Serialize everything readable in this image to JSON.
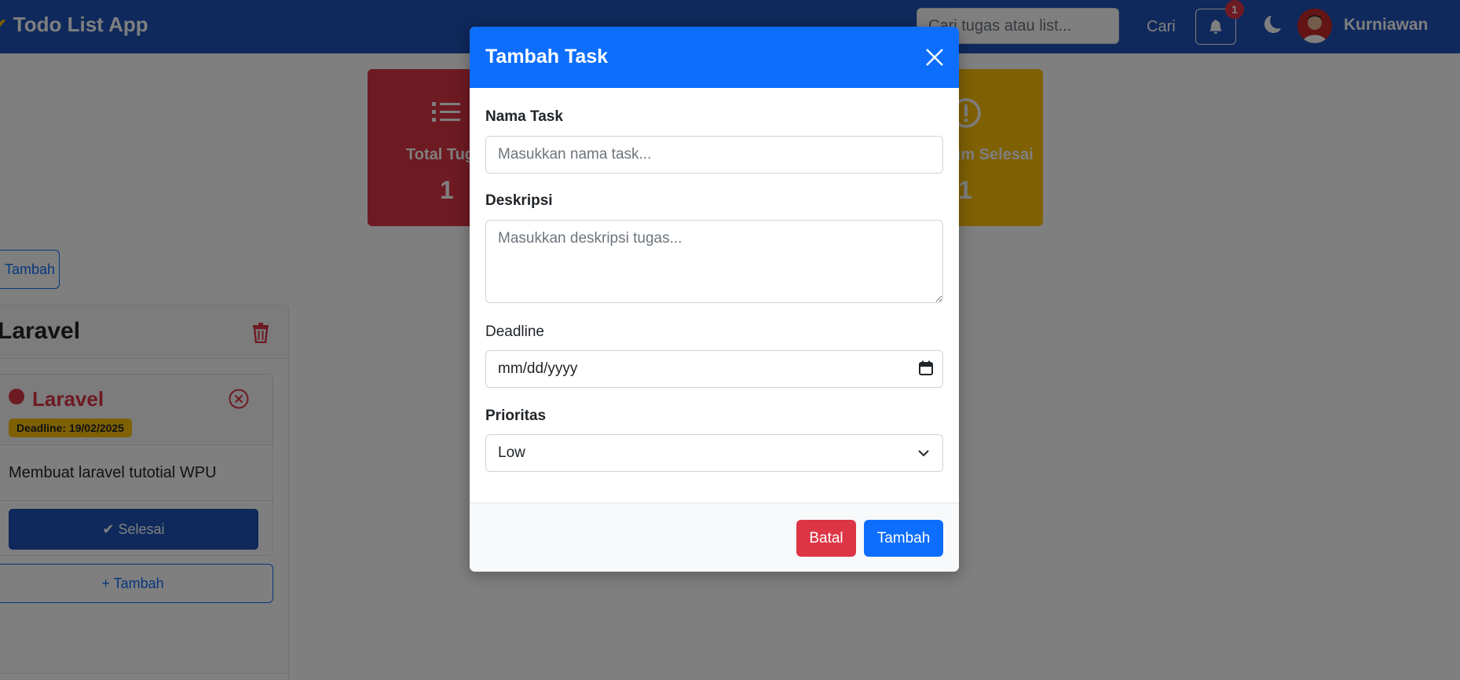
{
  "app": {
    "title": "Todo List App",
    "search_placeholder": "Cari tugas atau list...",
    "search_button": "Cari",
    "notification_count": "1",
    "username": "Kurniawan"
  },
  "stats": [
    {
      "label": "Total Tugas",
      "value": "1",
      "color": "#dc3545",
      "icon": "list-icon"
    },
    {
      "label": "Belum Selesai",
      "value": "1",
      "color": "#ffc107",
      "icon": "exclamation-circle-icon"
    }
  ],
  "lists": {
    "add_button": "Tambah",
    "items": [
      {
        "title": "Laravel",
        "tasks": [
          {
            "name": "Laravel",
            "deadline": "Deadline: 19/02/2025",
            "description": "Membuat laravel tutotial WPU",
            "done_button": "Selesai"
          }
        ],
        "add_task_button": "+ Tambah"
      }
    ]
  },
  "modal": {
    "title": "Tambah Task",
    "fields": {
      "name_label": "Nama Task",
      "name_placeholder": "Masukkan nama task...",
      "description_label": "Deskripsi",
      "description_placeholder": "Masukkan deskripsi tugas...",
      "deadline_label": "Deadline",
      "deadline_placeholder": "mm/dd/yyyy",
      "priority_label": "Prioritas",
      "priority_value": "Low"
    },
    "cancel_button": "Batal",
    "submit_button": "Tambah"
  },
  "colors": {
    "navbar": "#1e52b8",
    "primary": "#0d6efd",
    "danger": "#dc3545",
    "warning": "#ffc107"
  }
}
